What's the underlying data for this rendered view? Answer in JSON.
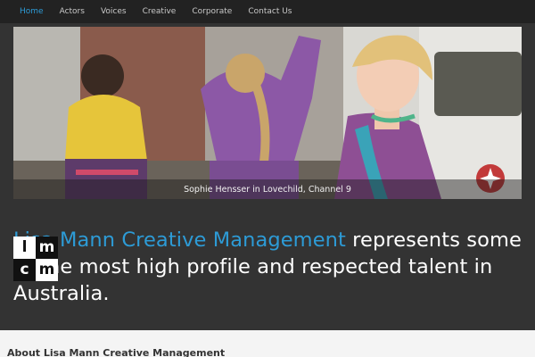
{
  "nav": {
    "items": [
      {
        "label": "Home"
      },
      {
        "label": "Actors"
      },
      {
        "label": "Voices"
      },
      {
        "label": "Creative"
      },
      {
        "label": "Corporate"
      },
      {
        "label": "Contact Us"
      }
    ],
    "active_color": "#2d9bd6"
  },
  "slide": {
    "caption": "Sophie Hensser in Lovechild, Channel 9"
  },
  "tagline": {
    "brand": "Lisa Mann Creative Management",
    "rest": " represents some of the most high profile and respected talent in Australia."
  },
  "logo": {
    "letters": [
      "l",
      "m",
      "c",
      "m"
    ]
  },
  "about": {
    "heading": "About Lisa Mann Creative Management"
  },
  "colors": {
    "nav_bg": "#222222",
    "hero_bg": "#333333",
    "accent": "#2d9bd6"
  }
}
